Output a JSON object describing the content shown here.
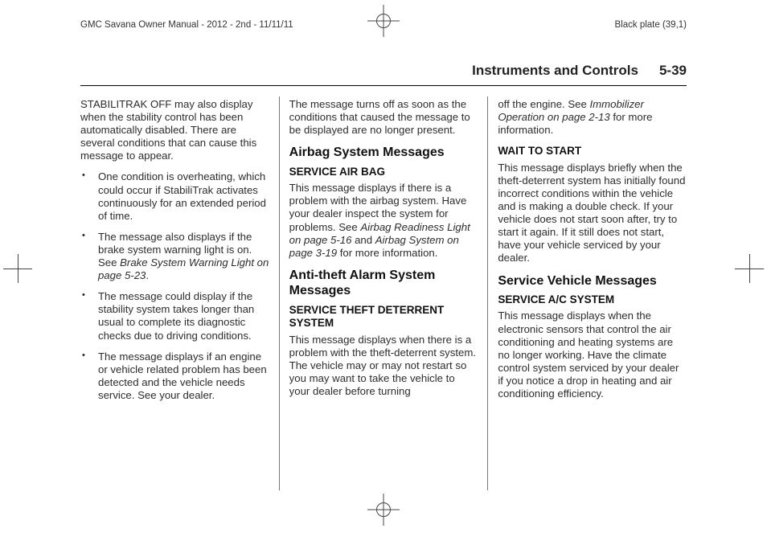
{
  "print_meta": {
    "left_label": "GMC Savana Owner Manual - 2012 - 2nd - 11/11/11",
    "right_label": "Black plate (39,1)"
  },
  "header": {
    "section_title": "Instruments and Controls",
    "page_number": "5-39"
  },
  "col1": {
    "intro": "STABILITRAK OFF may also display when the stability control has been automatically disabled. There are several conditions that can cause this message to appear.",
    "bullets": [
      {
        "text": "One condition is overheating, which could occur if StabiliTrak activates continuously for an extended period of time."
      },
      {
        "text_pre": "The message also displays if the brake system warning light is on. See ",
        "ref": "Brake System Warning Light on page 5-23",
        "text_post": "."
      },
      {
        "text": "The message could display if the stability system takes longer than usual to complete its diagnostic checks due to driving conditions."
      },
      {
        "text": "The message displays if an engine or vehicle related problem has been detected and the vehicle needs service. See your dealer."
      }
    ]
  },
  "col2": {
    "para1": "The message turns off as soon as the conditions that caused the message to be displayed are no longer present.",
    "h2_airbag": "Airbag System Messages",
    "h3_service_air_bag": "SERVICE AIR BAG",
    "airbag_pre": "This message displays if there is a problem with the airbag system. Have your dealer inspect the system for problems. See ",
    "airbag_ref1": "Airbag Readiness Light on page 5-16",
    "airbag_mid": " and ",
    "airbag_ref2": "Airbag System on page 3-19",
    "airbag_post": " for more information.",
    "h2_antitheft": "Anti-theft Alarm System Messages",
    "h3_service_theft": "SERVICE THEFT DETERRENT SYSTEM",
    "theft_para": "This message displays when there is a problem with the theft-deterrent system. The vehicle may or may not restart so you may want to take the vehicle to your dealer before turning"
  },
  "col3": {
    "cont_pre": "off the engine. See ",
    "cont_ref": "Immobilizer Operation on page 2-13",
    "cont_post": " for more information.",
    "h3_wait": "WAIT TO START",
    "wait_para": "This message displays briefly when the theft-deterrent system has initially found incorrect conditions within the vehicle and is making a double check. If your vehicle does not start soon after, try to start it again. If it still does not start, have your vehicle serviced by your dealer.",
    "h2_service_vehicle": "Service Vehicle Messages",
    "h3_service_ac": "SERVICE A/C SYSTEM",
    "ac_para": "This message displays when the electronic sensors that control the air conditioning and heating systems are no longer working. Have the climate control system serviced by your dealer if you notice a drop in heating and air conditioning efficiency."
  }
}
